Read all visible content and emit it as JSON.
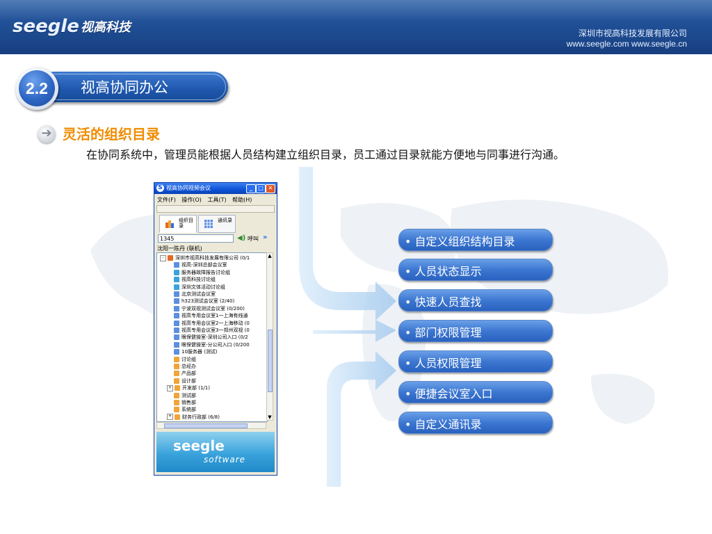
{
  "header": {
    "logo_text": "seegle",
    "logo_cn": "视高科技",
    "company": "深圳市视高科技发展有限公司",
    "urls": "www.seegle.com  www.seegle.cn"
  },
  "section": {
    "number": "2.2",
    "title": "视高协同办公"
  },
  "heading": "灵活的组织目录",
  "paragraph": "在协同系统中，管理员能根据人员结构建立组织目录，员工通过目录就能方便地与同事进行沟通。",
  "app_window": {
    "title": "视高协同视频会议",
    "menu": [
      "文件(F)",
      "操作(O)",
      "工具(T)",
      "帮助(H)"
    ],
    "tabs": [
      {
        "label": "组织目录",
        "icon": "org-tree-icon"
      },
      {
        "label": "通讯录",
        "icon": "address-grid-icon"
      }
    ],
    "search_value": "1345",
    "call_label": "呼叫",
    "user_status": "沈阳一陈丹 (联机)",
    "tree": [
      {
        "label": "深圳市视高科技发展有限公司 (0/1",
        "level": 0,
        "expander": "-",
        "icon": "company"
      },
      {
        "label": "视高-深圳总部会议室",
        "level": 1,
        "icon": "room"
      },
      {
        "label": "服务器故障报告讨论组",
        "level": 1,
        "icon": "group"
      },
      {
        "label": "视高科技讨论组",
        "level": 1,
        "icon": "group"
      },
      {
        "label": "深圳文体活动讨论组",
        "level": 1,
        "icon": "group"
      },
      {
        "label": "北京测试会议室",
        "level": 1,
        "icon": "room"
      },
      {
        "label": "h323测试会议室 (2/40)",
        "level": 1,
        "icon": "room"
      },
      {
        "label": "宁波双视测试会议室 (0/200)",
        "level": 1,
        "icon": "room"
      },
      {
        "label": "视高专用会议室1一上海有线通",
        "level": 1,
        "icon": "room"
      },
      {
        "label": "视高专用会议室2一上海移动 (0",
        "level": 1,
        "icon": "room"
      },
      {
        "label": "视高专用会议室3一郑州双视 (0",
        "level": 1,
        "icon": "room"
      },
      {
        "label": "眼保健操室-深圳公司入口 (0/2",
        "level": 1,
        "icon": "room"
      },
      {
        "label": "眼保健操室-分公司入口 (0/200",
        "level": 1,
        "icon": "room"
      },
      {
        "label": "10服务器 (测试)",
        "level": 1,
        "icon": "room"
      },
      {
        "label": "讨论组",
        "level": 1,
        "icon": "dept"
      },
      {
        "label": "总经办",
        "level": 1,
        "icon": "dept"
      },
      {
        "label": "产品部",
        "level": 1,
        "icon": "dept"
      },
      {
        "label": "设计部",
        "level": 1,
        "icon": "dept"
      },
      {
        "label": "开发部 (1/1)",
        "level": 1,
        "expander": "+",
        "icon": "dept"
      },
      {
        "label": "测试部",
        "level": 1,
        "icon": "dept"
      },
      {
        "label": "销售部",
        "level": 1,
        "icon": "dept"
      },
      {
        "label": "系统部",
        "level": 1,
        "icon": "dept"
      },
      {
        "label": "财务行政部 (6/8)",
        "level": 1,
        "expander": "+",
        "icon": "dept"
      }
    ],
    "footer_brand": "seegle",
    "footer_sub": "software"
  },
  "features": [
    "• 自定义组织结构目录",
    "• 人员状态显示",
    "• 快速人员查找",
    "• 部门权限管理",
    "• 人员权限管理",
    "• 便捷会议室入口",
    "• 自定义通讯录"
  ],
  "colors": {
    "header": "#1e4c92",
    "heading": "#f08c00",
    "pill": "#3c77d1"
  }
}
